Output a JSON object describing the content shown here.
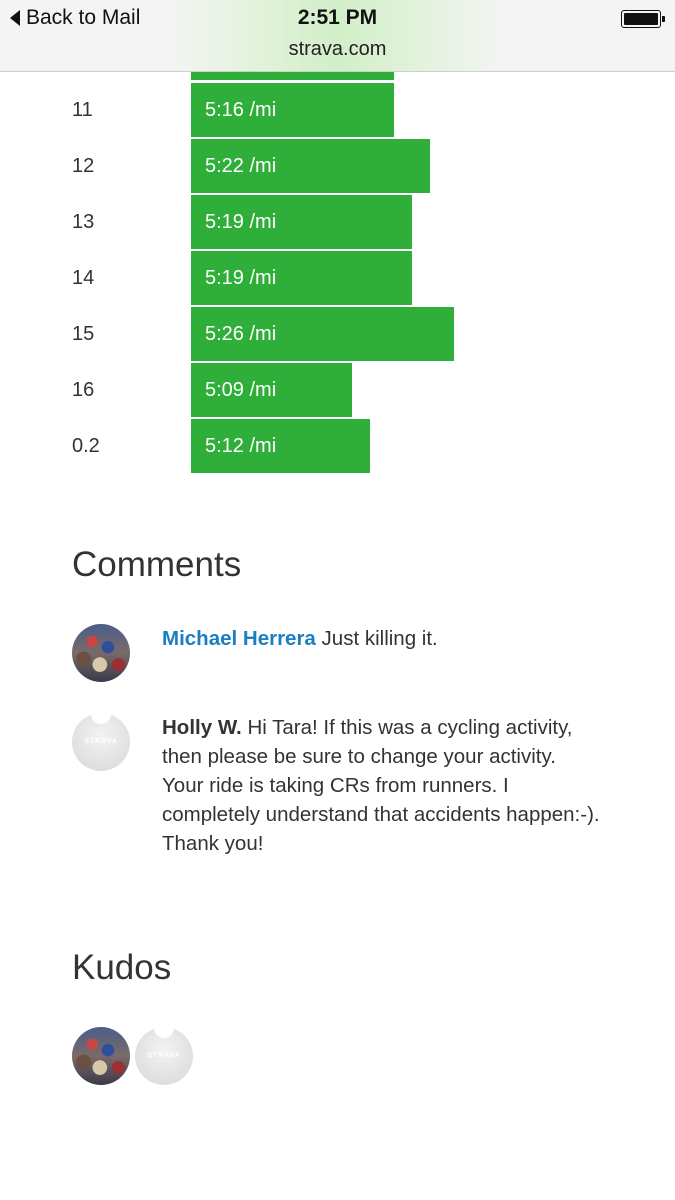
{
  "status_bar": {
    "back_label": "Back to Mail",
    "time": "2:51 PM",
    "url": "strava.com",
    "battery_level": 1.0
  },
  "splits": {
    "partial_bar_pace_seconds": 316,
    "rows": [
      {
        "label": "11",
        "pace": "5:16 /mi",
        "seconds": 316
      },
      {
        "label": "12",
        "pace": "5:22 /mi",
        "seconds": 322
      },
      {
        "label": "13",
        "pace": "5:19 /mi",
        "seconds": 319
      },
      {
        "label": "14",
        "pace": "5:19 /mi",
        "seconds": 319
      },
      {
        "label": "15",
        "pace": "5:26 /mi",
        "seconds": 326
      },
      {
        "label": "16",
        "pace": "5:09 /mi",
        "seconds": 309
      },
      {
        "label": "0.2",
        "pace": "5:12 /mi",
        "seconds": 312
      }
    ]
  },
  "comments": {
    "title": "Comments",
    "items": [
      {
        "author": "Michael Herrera",
        "text": "Just killing it.",
        "avatar": "photo",
        "linked": true
      },
      {
        "author": "Holly W.",
        "text": "Hi Tara! If this was a cycling activity, then please be sure to change your activity. Your ride is taking CRs from runners. I completely understand that accidents happen:-). Thank you!",
        "avatar": "default",
        "linked": false
      }
    ]
  },
  "kudos": {
    "title": "Kudos",
    "avatars": [
      "photo",
      "default"
    ]
  },
  "colors": {
    "split_bar": "#2fae3a",
    "author_link": "#1a7fc1"
  }
}
